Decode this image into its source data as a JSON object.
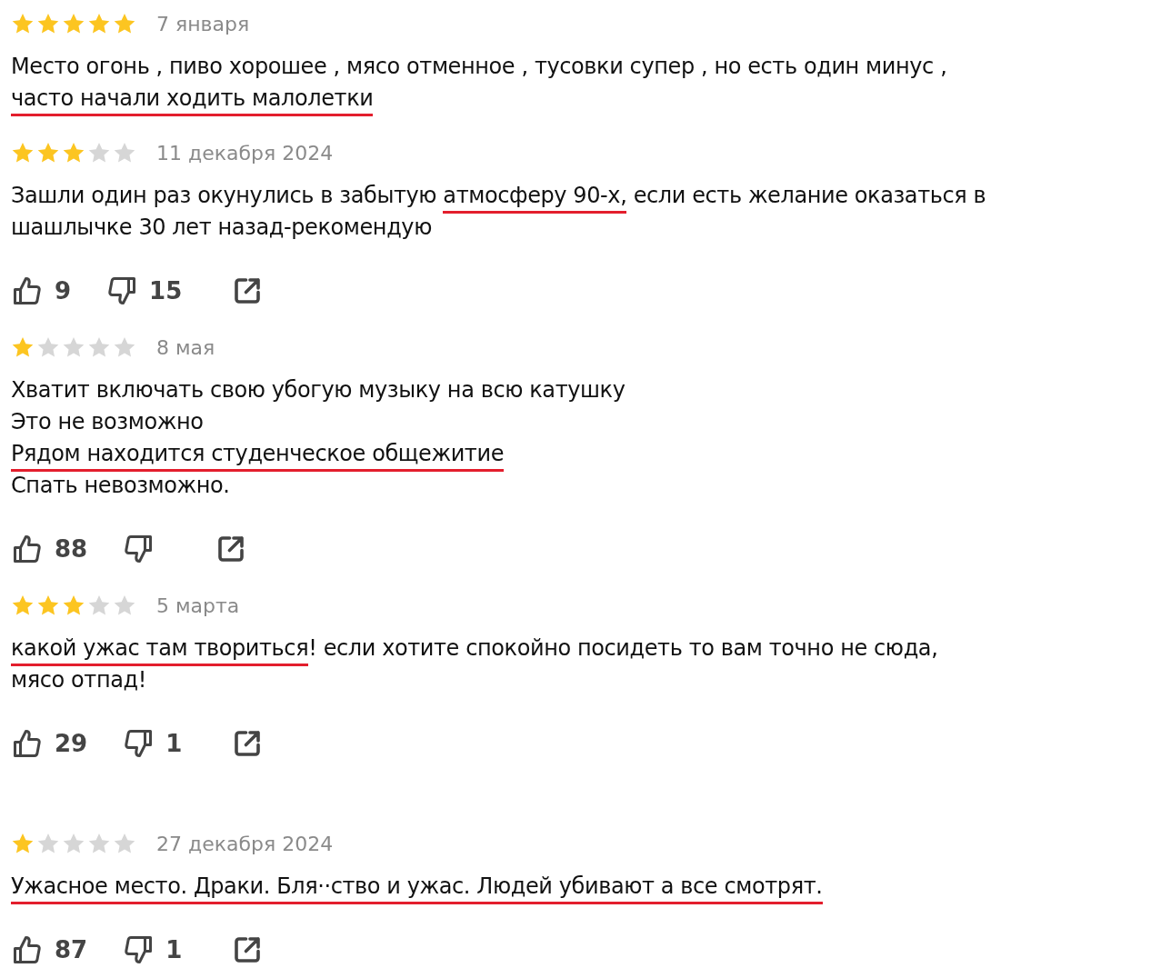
{
  "reviews": [
    {
      "stars": 5,
      "date": "7 января",
      "lines": [
        [
          {
            "text": "Место огонь , пиво хорошее , мясо отменное , тусовки супер , но есть один минус ,",
            "underlined": false
          }
        ],
        [
          {
            "text": "часто начали ходить малолетки",
            "underlined": true
          }
        ]
      ]
    },
    {
      "stars": 3,
      "date": "11 декабря 2024",
      "lines": [
        [
          {
            "text": "Зашли один раз окунулись в забытую ",
            "underlined": false
          },
          {
            "text": "атмосферу 90-х,",
            "underlined": true
          },
          {
            "text": " если есть желание оказаться в",
            "underlined": false
          }
        ],
        [
          {
            "text": "шашлычке 30 лет назад-рекомендую",
            "underlined": false
          }
        ]
      ],
      "reactions": {
        "likes": "9",
        "dislikes": "15"
      }
    },
    {
      "stars": 1,
      "date": "8 мая",
      "lines": [
        [
          {
            "text": "Хватит включать свою убогую музыку на всю катушку",
            "underlined": false
          }
        ],
        [
          {
            "text": "Это не возможно",
            "underlined": false
          }
        ],
        [
          {
            "text": "Рядом находится студенческое общежитие",
            "underlined": true
          }
        ],
        [
          {
            "text": "Спать невозможно.",
            "underlined": false
          }
        ]
      ],
      "reactions": {
        "likes": "88"
      }
    },
    {
      "stars": 3,
      "date": "5 марта",
      "lines": [
        [
          {
            "text": "какой ужас там твориться",
            "underlined": true
          },
          {
            "text": "! если хотите спокойно посидеть то вам точно не сюда,",
            "underlined": false
          }
        ],
        [
          {
            "text": "мясо отпад!",
            "underlined": false
          }
        ]
      ],
      "reactions": {
        "likes": "29",
        "dislikes": "1"
      }
    },
    {
      "stars": 1,
      "date": "27 декабря 2024",
      "lines": [
        [
          {
            "text": "Ужасное место. Драки. Бля··ство и ужас. Людей убивают а все смотрят.",
            "underlined": true
          }
        ]
      ],
      "reactions": {
        "likes": "87",
        "dislikes": "1"
      }
    }
  ]
}
